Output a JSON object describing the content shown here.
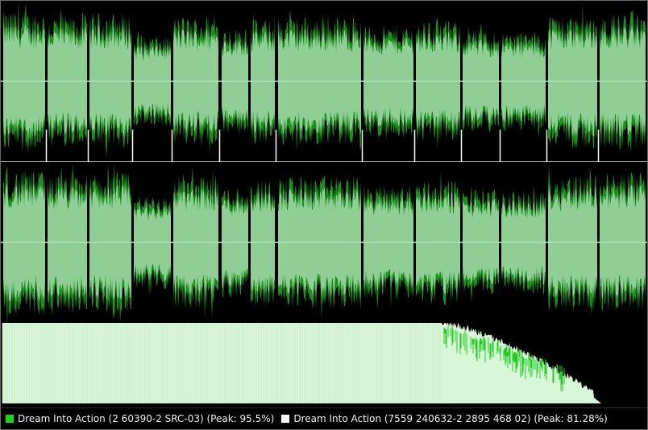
{
  "window": {
    "type": "audio-waveform-comparison"
  },
  "colors": {
    "background": "#000000",
    "track1_color": "#1fd41f",
    "track1_fill": "#8fcf96",
    "track2_color": "#ffffff",
    "centerline": "#c8f0c8",
    "divider": "#9a9a9a",
    "histogram_light": "#d8f7d8",
    "histogram_green": "#22cc22",
    "marker_color": "#ffffff"
  },
  "legend": [
    {
      "label": "Dream Into Action (2 60390-2 SRC-03) (Peak: 95.5%)",
      "swatch_color": "#1fd41f",
      "icon": "green-square-icon"
    },
    {
      "label": "Dream Into Action (7559 240632-2 2895 468 02) (Peak: 81.28%)",
      "swatch_color": "#ffffff",
      "icon": "white-square-icon"
    }
  ],
  "waveform": {
    "channels": [
      "left",
      "right"
    ],
    "segment_amplitudes": [
      0.93,
      0.88,
      0.9,
      0.6,
      0.86,
      0.72,
      0.82,
      0.85,
      0.74,
      0.8,
      0.68,
      0.66,
      0.89,
      0.9
    ]
  }
}
